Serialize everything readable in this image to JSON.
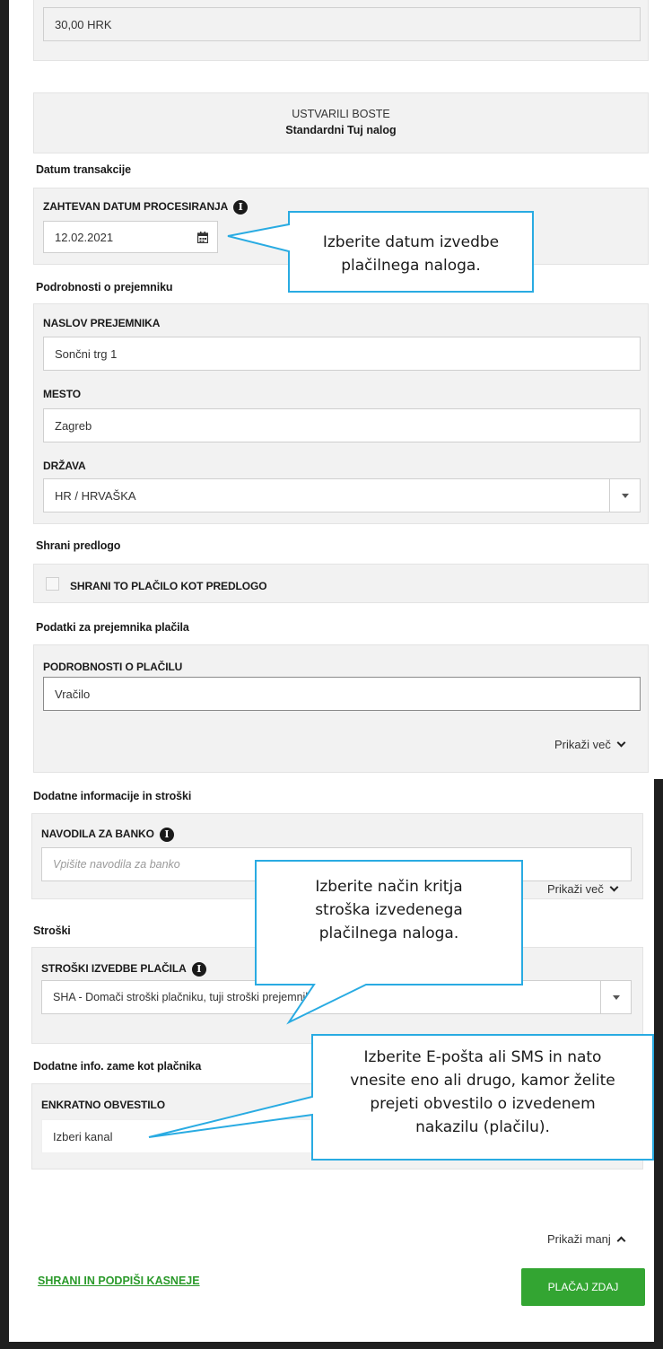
{
  "amount": {
    "value": "30,00 HRK"
  },
  "summary": {
    "line1": "USTVARILI BOSTE",
    "line2": "Standardni Tuj nalog"
  },
  "transaction_date": {
    "heading": "Datum transakcije",
    "label": "ZAHTEVAN DATUM PROCESIRANJA",
    "value": "12.02.2021",
    "icon": "calendar-icon"
  },
  "recipient": {
    "heading": "Podrobnosti o prejemniku",
    "address_label": "NASLOV PREJEMNIKA",
    "address_value": "Sončni trg 1",
    "city_label": "MESTO",
    "city_value": "Zagreb",
    "country_label": "DRŽAVA",
    "country_value": "HR / HRVAŠKA"
  },
  "template": {
    "heading": "Shrani predlogo",
    "checkbox_label": "SHRANI TO PLAČILO KOT PREDLOGO"
  },
  "payee_data": {
    "heading": "Podatki za prejemnika plačila",
    "details_label": "PODROBNOSTI O PLAČILU",
    "details_value": "Vračilo",
    "show_more": "Prikaži več"
  },
  "additional": {
    "heading": "Dodatne informacije in stroški",
    "bank_label": "NAVODILA ZA BANKO",
    "bank_placeholder": "Vpišite navodila za banko",
    "show_more": "Prikaži več"
  },
  "costs": {
    "heading": "Stroški",
    "label": "STROŠKI IZVEDBE PLAČILA",
    "value": "SHA - Domači stroški plačniku, tuji stroški prejemniku"
  },
  "notify": {
    "heading": "Dodatne info. zame kot plačnika",
    "label": "ENKRATNO OBVESTILO",
    "value": "Izberi kanal"
  },
  "footer": {
    "show_less": "Prikaži manj",
    "save_link": "SHRANI IN PODPIŠI KASNEJE",
    "pay_button": "PLAČAJ ZDAJ"
  },
  "callouts": {
    "date": [
      "Izberite datum izvedbe",
      "plačilnega naloga."
    ],
    "costs": [
      "Izberite način kritja",
      "stroška izvedenega",
      "plačilnega naloga."
    ],
    "notify": [
      "Izberite E-pošta ali SMS in nato",
      "vnesite eno ali drugo, kamor želite",
      "prejeti obvestilo o izvedenem",
      "nakazilu (plačilu)."
    ]
  },
  "colors": {
    "accent_green": "#33a532",
    "callout_border": "#29abe2",
    "panel_bg": "#f2f2f2"
  }
}
